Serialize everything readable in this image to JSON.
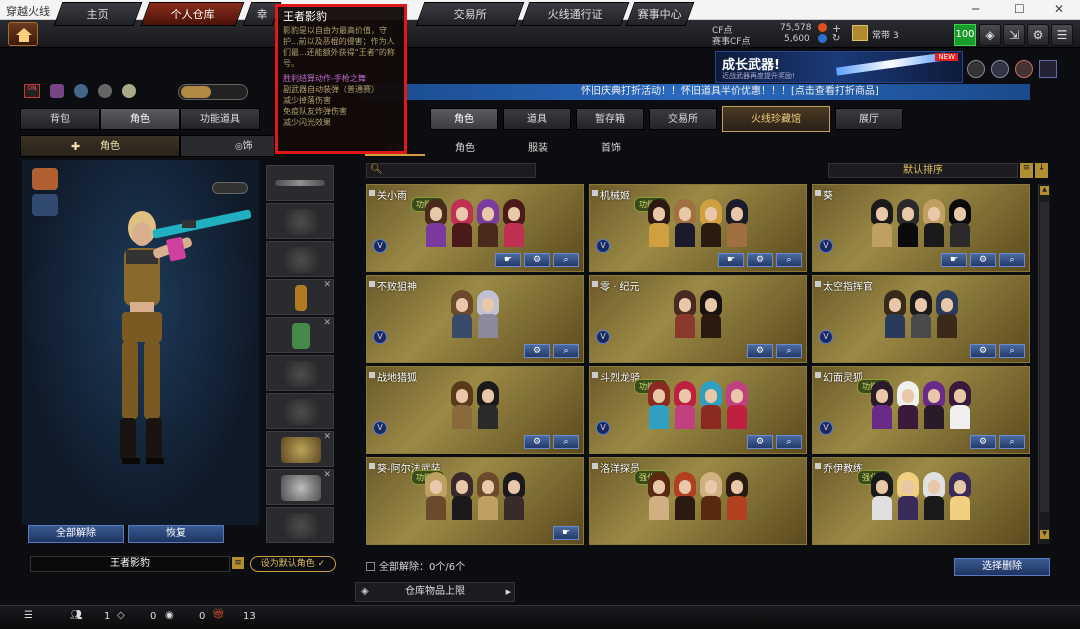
{
  "window": {
    "title": "穿越火线"
  },
  "topnav": {
    "tabs": [
      {
        "label": "主页"
      },
      {
        "label": "个人仓库",
        "active": true
      },
      {
        "label": "幸"
      },
      {
        "label": "交易所"
      },
      {
        "label": "火线通行证"
      },
      {
        "label": "赛事中心"
      }
    ]
  },
  "currency": {
    "cf_label": "CF点",
    "cf_value": "75,578",
    "match_label": "赛事CF点",
    "match_value": "5,600"
  },
  "user": {
    "rank": "常带",
    "rank_num": "3",
    "level": "100"
  },
  "banner": {
    "title": "成长武器!",
    "subtitle": "近战武器再度提升奖励!",
    "tag": "NEW"
  },
  "marquee": "怀旧庆典打折活动！！怀旧道具半价优惠！！！[点击查看打折商品]",
  "left_tabs": [
    {
      "label": "背包"
    },
    {
      "label": "角色",
      "active": true
    },
    {
      "label": "功能道具"
    }
  ],
  "left_subtabs": [
    {
      "label": "角色",
      "active": true
    },
    {
      "label": "饰"
    }
  ],
  "right_tabs": [
    {
      "label": "角色",
      "active": true
    },
    {
      "label": "道具"
    },
    {
      "label": "暂存箱"
    },
    {
      "label": "交易所"
    },
    {
      "label": "火线珍藏馆",
      "highlight": true
    },
    {
      "label": "展厅"
    }
  ],
  "right_subtabs": [
    {
      "label": "全部",
      "active": true
    },
    {
      "label": "角色"
    },
    {
      "label": "服装"
    },
    {
      "label": "首饰"
    }
  ],
  "sort_label": "默认排序",
  "characters": [
    {
      "name": "关小雨",
      "badge": "功能型"
    },
    {
      "name": "机械姬",
      "badge": "功能型"
    },
    {
      "name": "葵",
      "badge": ""
    },
    {
      "name": "不败狙神",
      "badge": ""
    },
    {
      "name": "零 · 纪元",
      "badge": ""
    },
    {
      "name": "太空指挥官",
      "badge": ""
    },
    {
      "name": "战地猎狐",
      "badge": ""
    },
    {
      "name": "斗烈龙骑",
      "badge": "功能型"
    },
    {
      "name": "幻面灵狐",
      "badge": "功能型"
    },
    {
      "name": "葵-阿尔法武装",
      "badge": "功能型"
    },
    {
      "name": "洛洋探员",
      "badge": "强化型"
    },
    {
      "name": "乔伊教练",
      "badge": "强化型"
    }
  ],
  "tooltip": {
    "title": "王者影豹",
    "desc": "影豹是以自由为最高价值，守护...前以及恶棍的侵害；作为人们最...还能额外获得“王者”的称号。",
    "features": [
      "胜利结算动作-手枪之舞",
      "副武器自动装弹（普通赛）",
      "减少掉落伤害",
      "免疫队友炸弹伤害",
      "减少闪光效果"
    ]
  },
  "left_buttons": {
    "unequip_all": "全部解除",
    "restore": "恢复"
  },
  "selected_char": {
    "name": "王者影豹",
    "set_default": "设为默认角色"
  },
  "bottom": {
    "unequip_all_label": "全部解除：",
    "unequip_count": "0个/6个",
    "select_delete": "选择删除",
    "storage_limit": "仓库物品上限"
  },
  "statusbar": {
    "friends": "1",
    "messages": "0",
    "chat": "0",
    "gifts": "13"
  },
  "colors": {
    "accent": "#e01818",
    "gold": "#9b8a45",
    "blue": "#2a6ac0"
  }
}
